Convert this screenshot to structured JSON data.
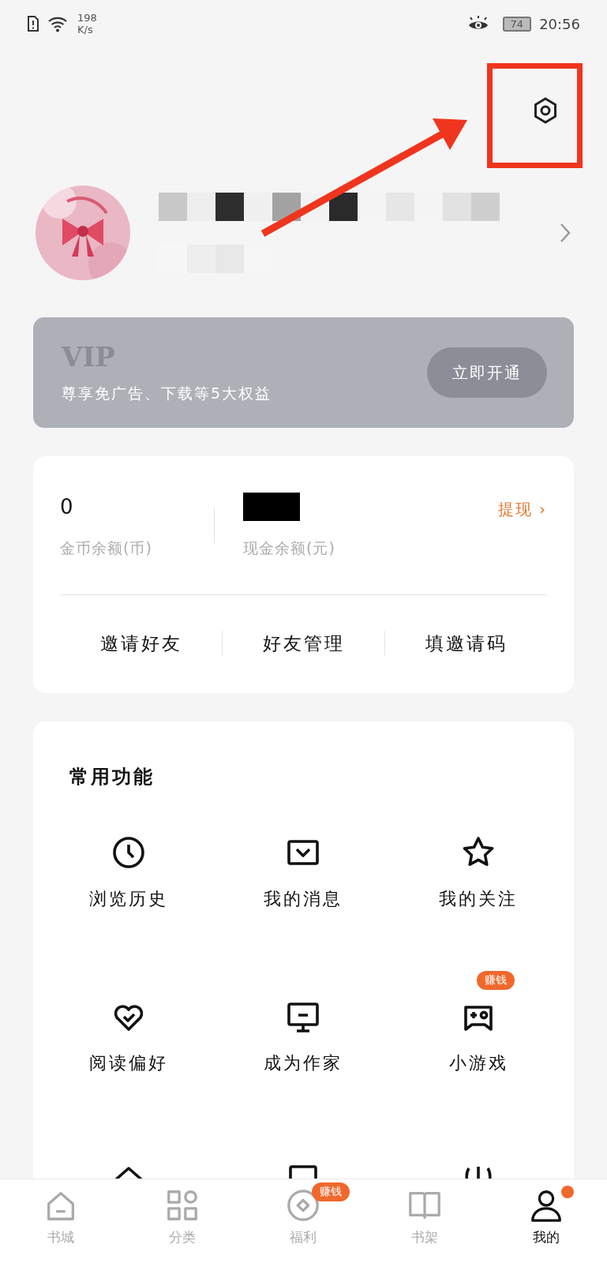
{
  "status_bar": {
    "speed_value": "198",
    "speed_unit": "K/s",
    "battery": "74",
    "time": "20:56"
  },
  "vip": {
    "title": "VIP",
    "subtitle": "尊享免广告、下载等5大权益",
    "button": "立即开通"
  },
  "wallet": {
    "coins": {
      "value": "0",
      "label": "金币余额(币)"
    },
    "cash": {
      "label": "现金余额(元)"
    },
    "withdraw": "提现 ›",
    "actions": [
      "邀请好友",
      "好友管理",
      "填邀请码"
    ]
  },
  "functions": {
    "title": "常用功能",
    "items": [
      {
        "label": "浏览历史"
      },
      {
        "label": "我的消息"
      },
      {
        "label": "我的关注"
      },
      {
        "label": "阅读偏好"
      },
      {
        "label": "成为作家"
      },
      {
        "label": "小游戏",
        "badge": "赚钱"
      },
      {
        "kind": "icon_only"
      },
      {
        "kind": "icon_only"
      },
      {
        "kind": "icon_only"
      }
    ]
  },
  "bottom_nav": [
    {
      "label": "书城",
      "selected": false
    },
    {
      "label": "分类",
      "selected": false
    },
    {
      "label": "福利",
      "selected": false,
      "badge": "赚钱"
    },
    {
      "label": "书架",
      "selected": false
    },
    {
      "label": "我的",
      "selected": true,
      "dot": true
    }
  ]
}
